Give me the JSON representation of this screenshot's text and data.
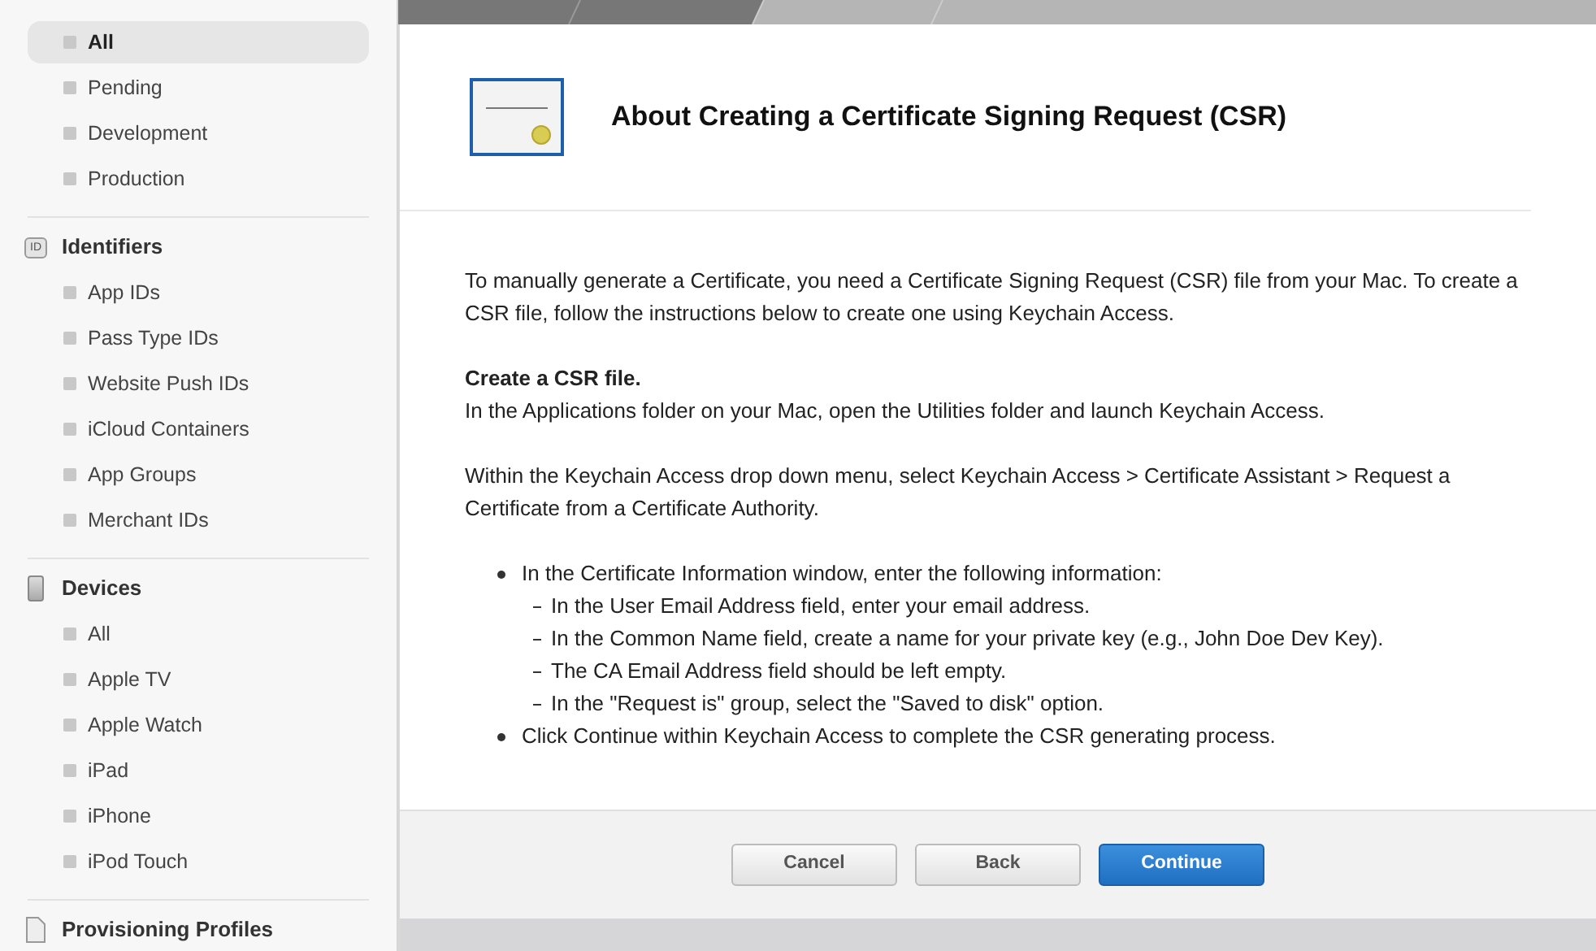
{
  "sidebar": {
    "sections": [
      {
        "items": [
          {
            "label": "All",
            "selected": true
          },
          {
            "label": "Pending",
            "selected": false
          },
          {
            "label": "Development",
            "selected": false
          },
          {
            "label": "Production",
            "selected": false
          }
        ]
      },
      {
        "title": "Identifiers",
        "kind": "id",
        "icon_text": "ID",
        "items": [
          {
            "label": "App IDs",
            "selected": false
          },
          {
            "label": "Pass Type IDs",
            "selected": false
          },
          {
            "label": "Website Push IDs",
            "selected": false
          },
          {
            "label": "iCloud Containers",
            "selected": false
          },
          {
            "label": "App Groups",
            "selected": false
          },
          {
            "label": "Merchant IDs",
            "selected": false
          }
        ]
      },
      {
        "title": "Devices",
        "kind": "device",
        "items": [
          {
            "label": "All",
            "selected": false
          },
          {
            "label": "Apple TV",
            "selected": false
          },
          {
            "label": "Apple Watch",
            "selected": false
          },
          {
            "label": "iPad",
            "selected": false
          },
          {
            "label": "iPhone",
            "selected": false
          },
          {
            "label": "iPod Touch",
            "selected": false
          }
        ]
      },
      {
        "title": "Provisioning Profiles",
        "kind": "document"
      }
    ]
  },
  "content": {
    "title": "About Creating a Certificate Signing Request (CSR)",
    "blocks": [
      {
        "kind": "paragraph",
        "text": "To manually generate a Certificate, you need a Certificate Signing Request (CSR) file from your Mac. To create a CSR file, follow the instructions below to create one using Keychain Access."
      },
      {
        "kind": "section",
        "heading": "Create a CSR file.",
        "text": "In the Applications folder on your Mac, open the Utilities folder and launch Keychain Access."
      },
      {
        "kind": "paragraph",
        "text": "Within the Keychain Access drop down menu, select Keychain Access > Certificate Assistant > Request a Certificate from a Certificate Authority."
      },
      {
        "kind": "bullets",
        "items": [
          {
            "text": "In the Certificate Information window, enter the following information:",
            "children": [
              {
                "text": "In the User Email Address field, enter your email address."
              },
              {
                "text": "In the Common Name field, create a name for your private key (e.g., John Doe Dev Key)."
              },
              {
                "text": "The CA Email Address field should be left empty."
              },
              {
                "text": "In the \"Request is\" group, select the \"Saved to disk\" option."
              }
            ]
          },
          {
            "text": "Click Continue within Keychain Access to complete the CSR generating process."
          }
        ]
      }
    ]
  },
  "buttons": [
    {
      "label": "Cancel",
      "kind": "secondary"
    },
    {
      "label": "Back",
      "kind": "secondary"
    },
    {
      "label": "Continue",
      "kind": "primary"
    }
  ]
}
